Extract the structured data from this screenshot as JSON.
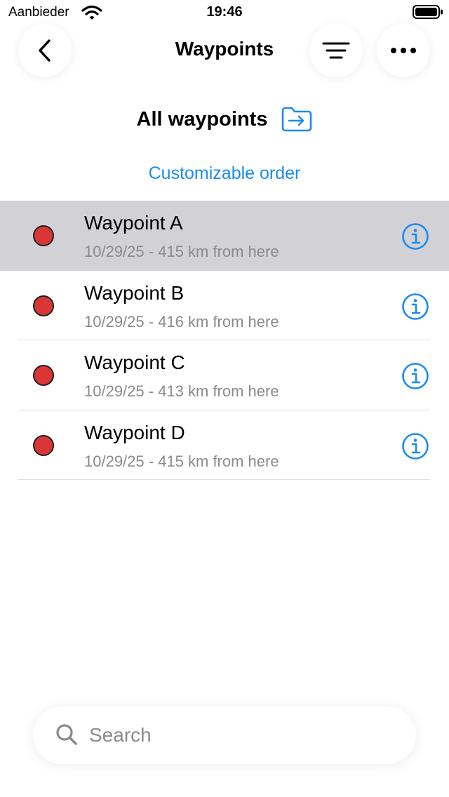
{
  "status_bar": {
    "carrier": "Aanbieder",
    "time": "19:46"
  },
  "nav": {
    "title": "Waypoints"
  },
  "header": {
    "title": "All waypoints"
  },
  "order_link": "Customizable order",
  "waypoints": [
    {
      "name": "Waypoint A",
      "detail": "10/29/25 - 415 km from here",
      "color": "#d93636",
      "selected": true
    },
    {
      "name": "Waypoint B",
      "detail": "10/29/25 - 416 km from here",
      "color": "#d93636",
      "selected": false
    },
    {
      "name": "Waypoint C",
      "detail": "10/29/25 - 413 km from here",
      "color": "#d93636",
      "selected": false
    },
    {
      "name": "Waypoint D",
      "detail": "10/29/25 - 415 km from here",
      "color": "#d93636",
      "selected": false
    }
  ],
  "search": {
    "placeholder": "Search",
    "value": ""
  },
  "colors": {
    "accent": "#1a8cf0",
    "selected_row": "#d1d1d6",
    "secondary_text": "#8a8a8e"
  },
  "icons": [
    "wifi-icon",
    "battery-icon",
    "back-chevron-icon",
    "filter-lines-icon",
    "more-dots-icon",
    "folder-move-icon",
    "waypoint-marker-icon",
    "info-icon",
    "search-icon"
  ]
}
